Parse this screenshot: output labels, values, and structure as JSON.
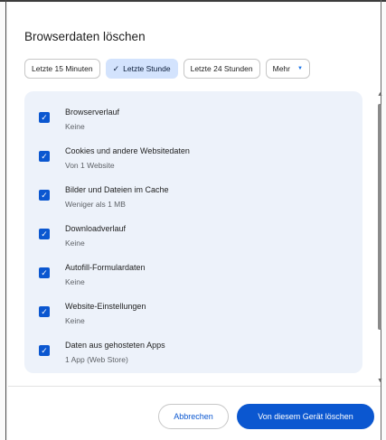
{
  "dialog": {
    "title": "Browserdaten löschen"
  },
  "time_chips": [
    {
      "label": "Letzte 15 Minuten",
      "selected": false
    },
    {
      "label": "Letzte Stunde",
      "selected": true
    },
    {
      "label": "Letzte 24 Stunden",
      "selected": false
    },
    {
      "label": "Mehr",
      "selected": false
    }
  ],
  "items": [
    {
      "title": "Browserverlauf",
      "subtitle": "Keine",
      "checked": true
    },
    {
      "title": "Cookies und andere Websitedaten",
      "subtitle": "Von 1 Website",
      "checked": true
    },
    {
      "title": "Bilder und Dateien im Cache",
      "subtitle": "Weniger als 1 MB",
      "checked": true
    },
    {
      "title": "Downloadverlauf",
      "subtitle": "Keine",
      "checked": true
    },
    {
      "title": "Autofill-Formulardaten",
      "subtitle": "Keine",
      "checked": true
    },
    {
      "title": "Website-Einstellungen",
      "subtitle": "Keine",
      "checked": true
    },
    {
      "title": "Daten aus gehosteten Apps",
      "subtitle": "1 App (Web Store)",
      "checked": true
    }
  ],
  "buttons": {
    "cancel": "Abbrechen",
    "delete": "Von diesem Gerät löschen"
  },
  "icons": {
    "check": "✓",
    "caret": "▼",
    "scroll_up": "▲",
    "scroll_down": "▼"
  },
  "colors": {
    "accent": "#0b57d0",
    "selected_chip_bg": "#d3e3fd",
    "list_bg": "#edf2fa"
  }
}
